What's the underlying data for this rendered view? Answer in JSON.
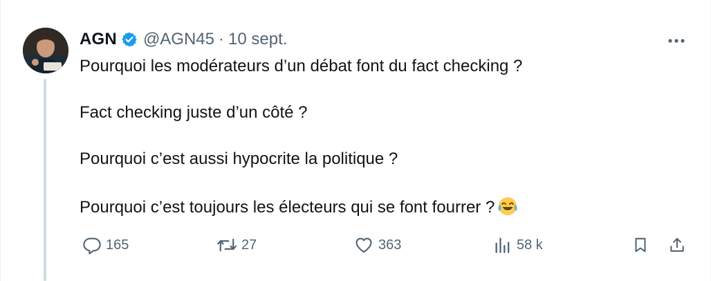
{
  "tweet": {
    "author_name": "AGN",
    "handle": "@AGN45",
    "separator": "·",
    "date": "10 sept.",
    "lines": [
      "Pourquoi les modérateurs d’un débat font du fact checking ?",
      "Fact checking juste d’un côté ?",
      "Pourquoi c’est aussi hypocrite la politique ?",
      "Pourquoi c’est toujours les électeurs qui se font fourrer ?"
    ],
    "emoji": "face-with-tears-of-joy"
  },
  "actions": {
    "replies": "165",
    "reposts": "27",
    "likes": "363",
    "views": "58 k"
  },
  "icons": {
    "verified": "verified-badge-icon",
    "more": "more-icon",
    "reply": "reply-icon",
    "repost": "repost-icon",
    "like": "heart-icon",
    "views": "views-icon",
    "bookmark": "bookmark-icon",
    "share": "share-icon"
  },
  "colors": {
    "verified": "#1d9bf0",
    "muted": "#536471",
    "thread_line": "#cfd9de",
    "text": "#0f1419"
  }
}
